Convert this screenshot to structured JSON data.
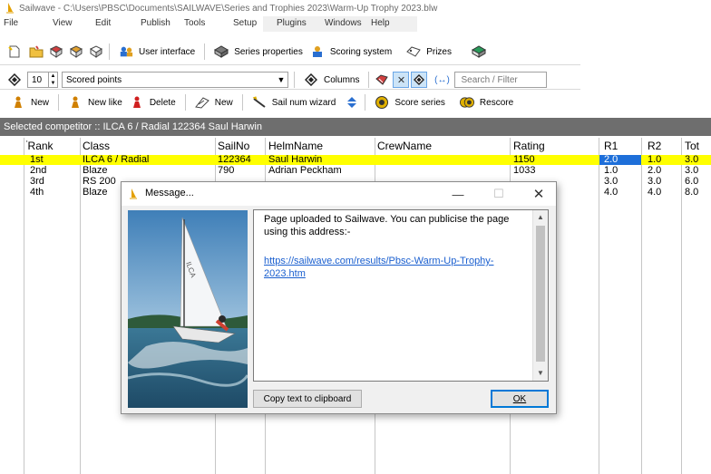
{
  "window": {
    "title": "Sailwave - C:\\Users\\PBSC\\Documents\\SAILWAVE\\Series and Trophies 2023\\Warm-Up Trophy 2023.blw"
  },
  "menu": {
    "items": [
      "File",
      "View",
      "Edit",
      "Publish",
      "Tools",
      "Setup",
      "Plugins",
      "Windows",
      "Help"
    ]
  },
  "toolbar1": {
    "user_interface": "User interface",
    "series_properties": "Series properties",
    "scoring_system": "Scoring system",
    "prizes": "Prizes"
  },
  "toolbar2": {
    "spin_value": "10",
    "combo_value": "Scored points",
    "columns": "Columns",
    "search_placeholder": "Search / Filter"
  },
  "toolbar3": {
    "new": "New",
    "new_like": "New like",
    "delete": "Delete",
    "new2": "New",
    "sail_num_wizard": "Sail num wizard",
    "score_series": "Score series",
    "rescore": "Rescore"
  },
  "banner": "Selected competitor :: ILCA 6 / Radial 122364 Saul Harwin",
  "grid": {
    "headers": {
      "rank": "Rank",
      "class": "Class",
      "sailno": "SailNo",
      "helm": "HelmName",
      "crew": "CrewName",
      "rating": "Rating",
      "r1": "R1",
      "r2": "R2",
      "tot": "Tot"
    },
    "rows": [
      {
        "rank": "1st",
        "class": "ILCA 6 / Radial",
        "sailno": "122364",
        "helm": "Saul Harwin",
        "crew": "",
        "rating": "1150",
        "r1": "2.0",
        "r2": "1.0",
        "tot": "3.0"
      },
      {
        "rank": "2nd",
        "class": "Blaze",
        "sailno": "790",
        "helm": "Adrian Peckham",
        "crew": "",
        "rating": "1033",
        "r1": "1.0",
        "r2": "2.0",
        "tot": "3.0"
      },
      {
        "rank": "3rd",
        "class": "RS 200",
        "sailno": "",
        "helm": "",
        "crew": "",
        "rating": "",
        "r1": "3.0",
        "r2": "3.0",
        "tot": "6.0"
      },
      {
        "rank": "4th",
        "class": "Blaze",
        "sailno": "",
        "helm": "",
        "crew": "",
        "rating": "",
        "r1": "4.0",
        "r2": "4.0",
        "tot": "8.0"
      }
    ]
  },
  "dialog": {
    "title": "Message...",
    "message": "Page uploaded to Sailwave. You can publicise the page using this address:-",
    "link": "https://sailwave.com/results/Pbsc-Warm-Up-Trophy-2023.htm",
    "copy_button": "Copy text to clipboard",
    "ok_button": "OK"
  },
  "colors": {
    "selected_row": "#ffff00",
    "r1_selected_cell": "#1e6fd9",
    "banner": "#6e6e6e",
    "link": "#1a5fcf"
  }
}
